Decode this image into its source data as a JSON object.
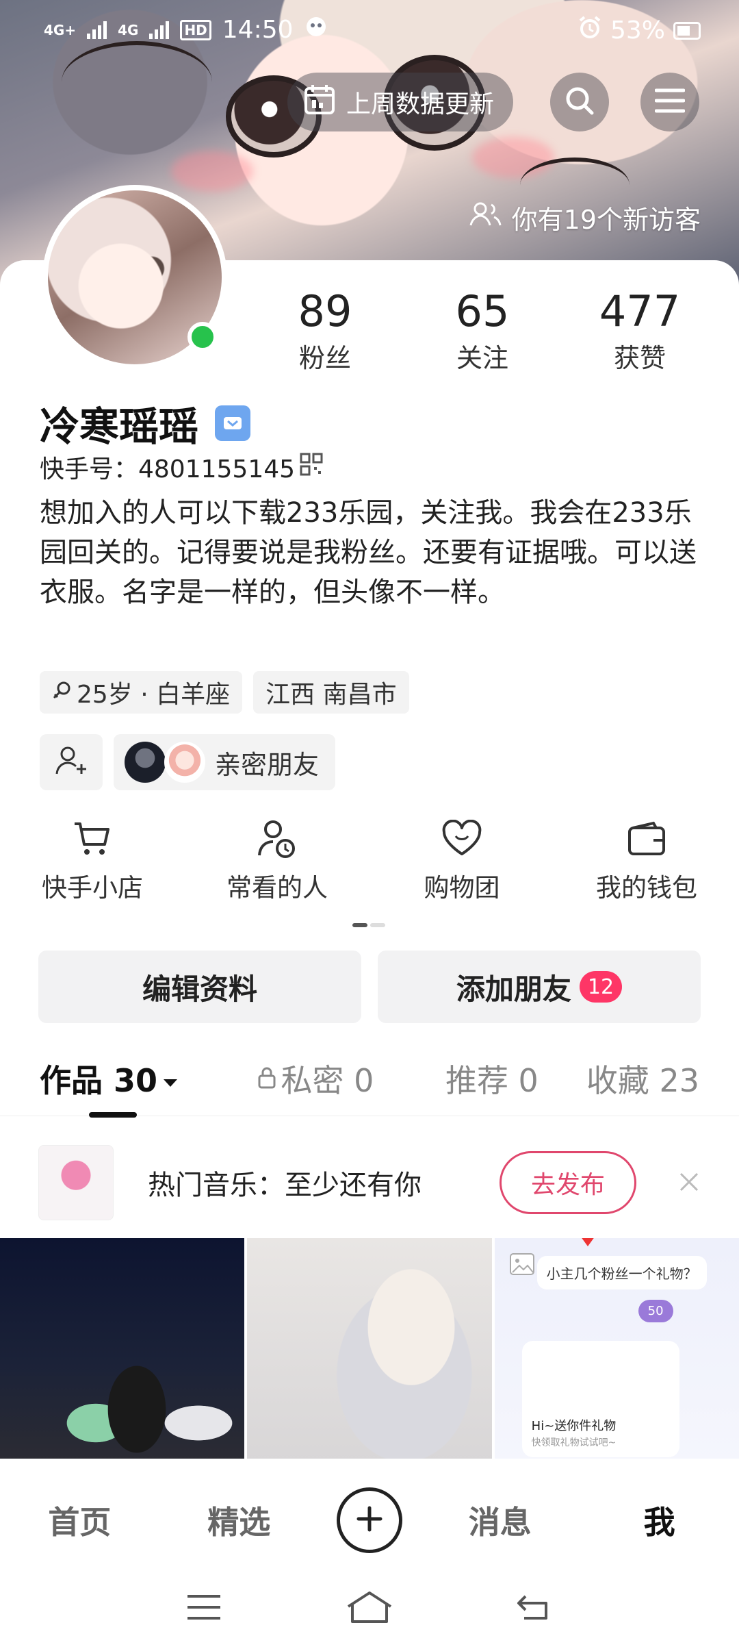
{
  "status_bar": {
    "network1": "4G+",
    "network2": "4G",
    "hd": "HD",
    "time": "14:50",
    "battery": "53%"
  },
  "header": {
    "data_update": "上周数据更新",
    "visitors": "你有19个新访客"
  },
  "stats": [
    {
      "value": "89",
      "label": "粉丝"
    },
    {
      "value": "65",
      "label": "关注"
    },
    {
      "value": "477",
      "label": "获赞"
    }
  ],
  "profile": {
    "name": "冷寒瑶瑶",
    "kuaishou_id": "快手号：4801155145",
    "bio": "想加入的人可以下载233乐园，关注我。我会在233乐园回关的。记得要说是我粉丝。还要有证据哦。可以送衣服。名字是一样的，但头像不一样。",
    "age_sign": "25岁 · 白羊座",
    "location": "江西 南昌市",
    "close_friends": "亲密朋友"
  },
  "quick_actions": [
    {
      "label": "快手小店",
      "icon": "cart-icon"
    },
    {
      "label": "常看的人",
      "icon": "person-clock-icon"
    },
    {
      "label": "购物团",
      "icon": "heart-icon"
    },
    {
      "label": "我的钱包",
      "icon": "wallet-icon"
    }
  ],
  "buttons": {
    "edit_profile": "编辑资料",
    "add_friend": "添加朋友",
    "add_friend_badge": "12"
  },
  "tabs": [
    {
      "label": "作品 30"
    },
    {
      "label": "私密 0"
    },
    {
      "label": "推荐 0"
    },
    {
      "label": "收藏 23"
    }
  ],
  "music": {
    "title": "热门音乐：至少还有你",
    "publish": "去发布"
  },
  "grid": {
    "cell3_bubble": "小主几个粉丝一个礼物？",
    "cell3_tag": "50",
    "cell3_title": "Hi~送你件礼物",
    "cell3_sub": "快领取礼物试试吧~"
  },
  "bottom_nav": [
    {
      "label": "首页"
    },
    {
      "label": "精选"
    },
    {
      "label": "消息"
    },
    {
      "label": "我"
    }
  ],
  "colors": {
    "accent_red": "#fe3666",
    "online_green": "#27c24c",
    "publish_pink": "#e0476d"
  }
}
